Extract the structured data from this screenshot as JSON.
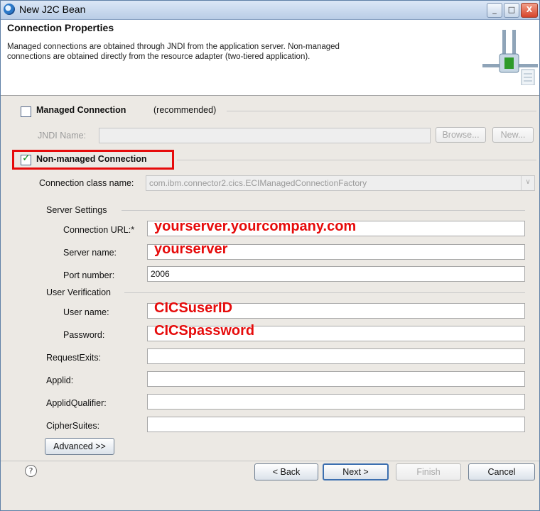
{
  "window": {
    "title": "New J2C Bean",
    "controls": {
      "minimize": "_",
      "maximize": "□",
      "close": "X"
    }
  },
  "header": {
    "title": "Connection Properties",
    "description_line1": "Managed connections are obtained through JNDI from the application server.  Non-managed",
    "description_line2": "connections are obtained directly from the resource adapter (two-tiered application)."
  },
  "managed": {
    "checked": false,
    "label": "Managed Connection",
    "note": "(recommended)",
    "jndi_label": "JNDI Name:",
    "jndi_value": "",
    "browse_label": "Browse...",
    "new_label": "New..."
  },
  "nonmanaged": {
    "checked": true,
    "label": "Non-managed Connection",
    "class_label": "Connection class name:",
    "class_value": "com.ibm.connector2.cics.ECIManagedConnectionFactory"
  },
  "server_settings": {
    "section": "Server Settings",
    "url_label": "Connection URL:*",
    "url_value": "yourserver.yourcompany.com",
    "server_label": "Server name:",
    "server_value": "yourserver",
    "port_label": "Port number:",
    "port_value": "2006"
  },
  "user_verification": {
    "section": "User Verification",
    "user_label": "User name:",
    "user_value": "CICSuserID",
    "password_label": "Password:",
    "password_value": "CICSpassword"
  },
  "extra": {
    "request_exits_label": "RequestExits:",
    "applid_label": "Applid:",
    "applid_qualifier_label": "ApplidQualifier:",
    "cipher_suites_label": "CipherSuites:",
    "advanced_label": "Advanced >>"
  },
  "footer": {
    "help": "?",
    "back": "< Back",
    "next": "Next >",
    "finish": "Finish",
    "cancel": "Cancel"
  },
  "colors": {
    "annotation_red": "#e60b0b",
    "title_gradient_top": "#dbe7f6",
    "dialog_bg": "#ece9e4"
  },
  "icons": [
    "app-icon",
    "connector-banner-icon",
    "checkbox-checked-icon",
    "dropdown-arrow-icon",
    "help-icon"
  ]
}
